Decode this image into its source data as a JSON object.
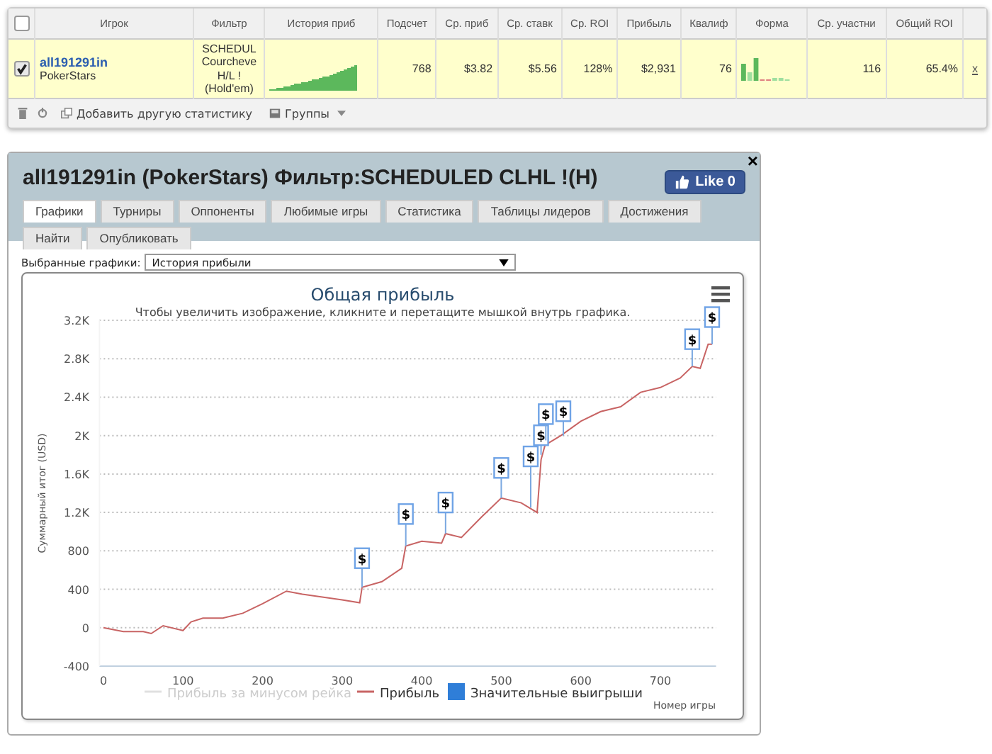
{
  "stats_table": {
    "header_checkbox": {
      "checked": false
    },
    "columns": [
      "Игрок",
      "Фильтр",
      "История приб",
      "Подсчет",
      "Ср. приб",
      "Ср. ставк",
      "Ср. ROI",
      "Прибыль",
      "Квалиф",
      "Форма",
      "Ср. участни",
      "Общий ROI"
    ],
    "rows": [
      {
        "selected": true,
        "player": "all191291in",
        "site": "PokerStars",
        "filter_lines": [
          "SCHEDUL",
          "Courcheve",
          "H/L !",
          "(Hold'em)"
        ],
        "count": "768",
        "avg_profit": "$3.82",
        "avg_stake": "$5.56",
        "avg_roi": "128%",
        "profit": "$2,931",
        "qualif": "76",
        "avg_entrants": "116",
        "total_roi": "65.4%",
        "remove": "x"
      }
    ],
    "toolbar": {
      "add_stat": "Добавить другую статистику",
      "groups": "Группы"
    }
  },
  "dialog": {
    "title": "all191291in (PokerStars) Фильтр:SCHEDULED CLHL !(H)",
    "like_button": "Like 0",
    "close": "×",
    "tabs": [
      {
        "label": "Графики",
        "selected": true
      },
      {
        "label": "Турниры",
        "selected": false
      },
      {
        "label": "Оппоненты",
        "selected": false
      },
      {
        "label": "Любимые игры",
        "selected": false
      },
      {
        "label": "Статистика",
        "selected": false
      },
      {
        "label": "Таблицы лидеров",
        "selected": false
      },
      {
        "label": "Достижения",
        "selected": false
      },
      {
        "label": "Найти",
        "selected": false
      },
      {
        "label": "Опубликовать",
        "selected": false
      }
    ],
    "chart_select": {
      "label": "Выбранные графики:",
      "value": "История прибыли"
    },
    "chart_panel": {
      "subtitle": "Чтобы увеличить изображение, кликните и перетащите мышкой внутрь графика.",
      "legend": [
        {
          "label": "Прибыль за минусом рейка",
          "kind": "line",
          "visible": false,
          "color": "#cccccc"
        },
        {
          "label": "Значительные выигрыши",
          "kind": "flag",
          "visible": true,
          "color": "#2f7ed8"
        }
      ],
      "win_flags": [
        {
          "label": "$"
        },
        {
          "label": "$"
        },
        {
          "label": "$"
        },
        {
          "label": "$"
        },
        {
          "label": "$"
        },
        {
          "label": "$"
        },
        {
          "label": "$"
        },
        {
          "label": "$"
        },
        {
          "label": "$"
        },
        {
          "label": "$"
        }
      ],
      "chart_data": {
        "type": "line",
        "title": "Общая прибыль",
        "xlabel": "Номер игры",
        "ylabel": "Суммарный итог (USD)",
        "grid": true,
        "x": [
          0,
          25,
          50,
          60,
          75,
          100,
          110,
          125,
          150,
          175,
          200,
          230,
          250,
          275,
          300,
          322,
          325,
          350,
          375,
          380,
          400,
          425,
          430,
          450,
          475,
          500,
          525,
          545,
          550,
          555,
          575,
          600,
          625,
          650,
          675,
          700,
          725,
          740,
          750,
          760,
          765
        ],
        "series": [
          {
            "name": "Прибыль",
            "color": "#c86464",
            "values": [
              0,
              -40,
              -40,
              -60,
              20,
              -30,
              60,
              100,
              100,
              150,
              250,
              380,
              350,
              320,
              290,
              260,
              420,
              480,
              620,
              850,
              900,
              880,
              980,
              940,
              1150,
              1350,
              1300,
              1200,
              1750,
              1900,
              2000,
              2150,
              2250,
              2300,
              2450,
              2500,
              2600,
              2720,
              2700,
              2950,
              2950
            ]
          }
        ],
        "xlim": [
          -5,
          770
        ],
        "ylim": [
          -400,
          3200
        ],
        "xticks": [
          0,
          100,
          200,
          300,
          400,
          500,
          600,
          700
        ],
        "yticks": [
          {
            "value": -400,
            "label": "-400"
          },
          {
            "value": 0,
            "label": "0"
          },
          {
            "value": 400,
            "label": "400"
          },
          {
            "value": 800,
            "label": "800"
          },
          {
            "value": 1200,
            "label": "1.2K"
          },
          {
            "value": 1600,
            "label": "1.6K"
          },
          {
            "value": 2000,
            "label": "2K"
          },
          {
            "value": 2400,
            "label": "2.4K"
          },
          {
            "value": 2800,
            "label": "2.8K"
          },
          {
            "value": 3200,
            "label": "3.2K"
          }
        ]
      }
    }
  }
}
